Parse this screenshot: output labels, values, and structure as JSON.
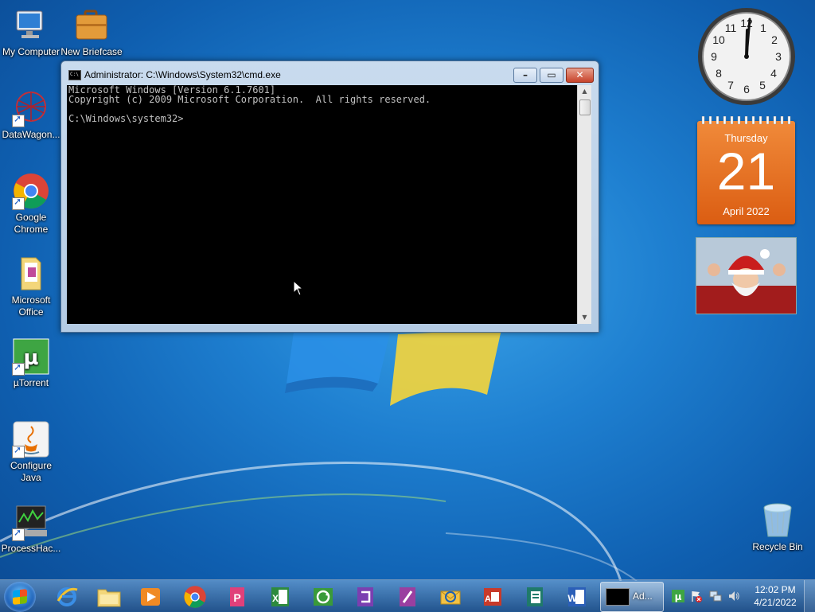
{
  "desktop": {
    "icons": [
      {
        "label": "My Computer"
      },
      {
        "label": "New Briefcase"
      },
      {
        "label": "DataWagon..."
      },
      {
        "label": "Google Chrome"
      },
      {
        "label": "Microsoft Office"
      },
      {
        "label": "µTorrent"
      },
      {
        "label": "Configure Java"
      },
      {
        "label": "ProcessHac..."
      },
      {
        "label": "Recycle Bin"
      }
    ]
  },
  "cmd_window": {
    "title": "Administrator: C:\\Windows\\System32\\cmd.exe",
    "minimize_label": "–",
    "maximize_label": "▭",
    "close_label": "✕",
    "console_lines": "Microsoft Windows [Version 6.1.7601]\nCopyright (c) 2009 Microsoft Corporation.  All rights reserved.\n\nC:\\Windows\\system32>"
  },
  "gadgets": {
    "clock": {
      "time": "12:02"
    },
    "calendar": {
      "weekday": "Thursday",
      "day": "21",
      "month_year": "April 2022"
    }
  },
  "taskbar": {
    "pinned": [
      "internet-explorer",
      "windows-explorer",
      "media-player",
      "google-chrome",
      "powerpoint-template",
      "excel",
      "sync-center",
      "onenote",
      "infopath",
      "outlook",
      "access",
      "publisher",
      "word"
    ],
    "active_task_label": "Ad...",
    "clock_time": "12:02 PM",
    "clock_date": "4/21/2022"
  },
  "colors": {
    "accent": "#1e7fd0",
    "calendar": "#e96a1f"
  }
}
